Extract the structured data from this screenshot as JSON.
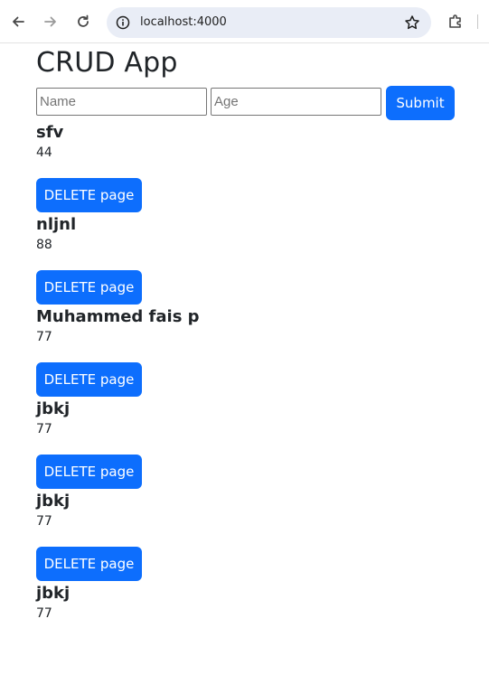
{
  "browser": {
    "url": "localhost:4000",
    "icons": [
      "back-arrow-icon",
      "forward-arrow-icon",
      "reload-icon",
      "site-info-icon",
      "bookmark-star-icon",
      "extensions-icon"
    ]
  },
  "app": {
    "title": "CRUD App",
    "form": {
      "name_placeholder": "Name",
      "age_placeholder": "Age",
      "name_value": "",
      "age_value": "",
      "submit_label": "Submit"
    },
    "delete_label": "DELETE page",
    "records": [
      {
        "name": "sfv",
        "age": "44"
      },
      {
        "name": "nljnl",
        "age": "88"
      },
      {
        "name": "Muhammed fais p",
        "age": "77"
      },
      {
        "name": "jbkj",
        "age": "77"
      },
      {
        "name": "jbkj",
        "age": "77"
      },
      {
        "name": "jbkj",
        "age": "77"
      }
    ]
  },
  "colors": {
    "primary": "#0d6efd",
    "omnibox_bg": "#e9edf6",
    "text": "#212529"
  }
}
